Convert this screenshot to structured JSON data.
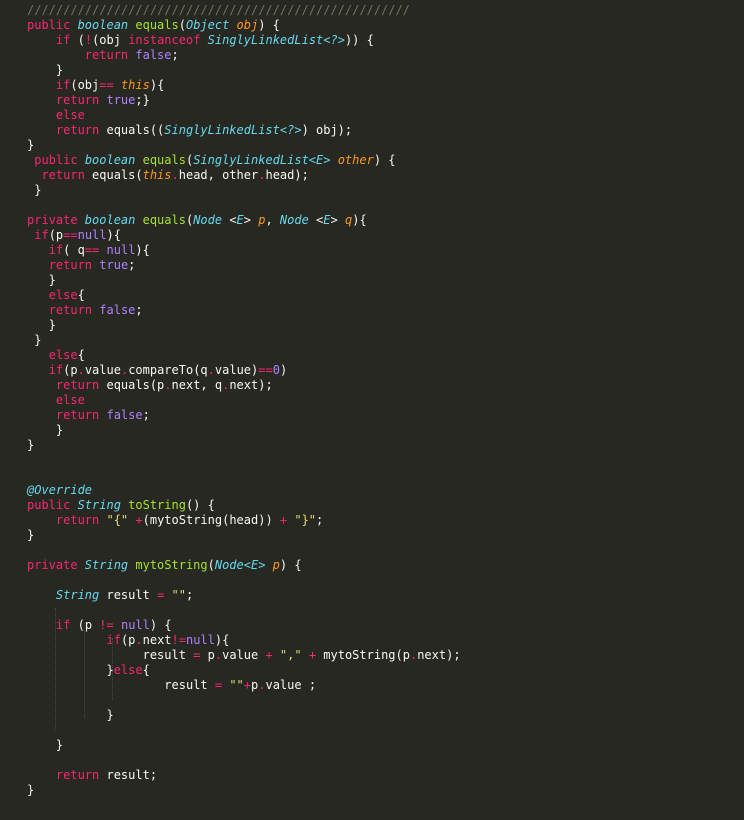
{
  "theme": {
    "background": "#272822",
    "keyword": "#f92672",
    "type": "#66d9ef",
    "function": "#a6e22e",
    "parameter": "#fd971f",
    "constant": "#ae81ff",
    "string": "#e6db74",
    "text": "#f8f8f2",
    "comment": "#75715e"
  },
  "editor": {
    "lines": [
      [
        {
          "t": "cm",
          "v": "/////////////////////////////////////////////////////"
        }
      ],
      [
        {
          "t": "kw",
          "v": "public "
        },
        {
          "t": "ty",
          "v": "boolean "
        },
        {
          "t": "fn",
          "v": "equals"
        },
        {
          "t": "tx",
          "v": "("
        },
        {
          "t": "ty",
          "v": "Object "
        },
        {
          "t": "pa",
          "v": "obj"
        },
        {
          "t": "tx",
          "v": ") {"
        }
      ],
      [
        {
          "t": "tx",
          "v": "    "
        },
        {
          "t": "kw",
          "v": "if "
        },
        {
          "t": "tx",
          "v": "("
        },
        {
          "t": "op",
          "v": "!"
        },
        {
          "t": "tx",
          "v": "(obj "
        },
        {
          "t": "kw",
          "v": "instanceof "
        },
        {
          "t": "ty",
          "v": "SinglyLinkedList<?>"
        },
        {
          "t": "tx",
          "v": ")) {"
        }
      ],
      [
        {
          "t": "tx",
          "v": "        "
        },
        {
          "t": "kw",
          "v": "return "
        },
        {
          "t": "co",
          "v": "false"
        },
        {
          "t": "tx",
          "v": ";"
        }
      ],
      [
        {
          "t": "tx",
          "v": "    }"
        }
      ],
      [
        {
          "t": "tx",
          "v": "    "
        },
        {
          "t": "kw",
          "v": "if"
        },
        {
          "t": "tx",
          "v": "(obj"
        },
        {
          "t": "op",
          "v": "== "
        },
        {
          "t": "pa",
          "v": "this"
        },
        {
          "t": "tx",
          "v": "){"
        }
      ],
      [
        {
          "t": "tx",
          "v": "    "
        },
        {
          "t": "kw",
          "v": "return "
        },
        {
          "t": "co",
          "v": "true"
        },
        {
          "t": "tx",
          "v": ";}"
        }
      ],
      [
        {
          "t": "tx",
          "v": "    "
        },
        {
          "t": "kw",
          "v": "else"
        }
      ],
      [
        {
          "t": "tx",
          "v": "    "
        },
        {
          "t": "kw",
          "v": "return "
        },
        {
          "t": "tx",
          "v": "equals(("
        },
        {
          "t": "ty",
          "v": "SinglyLinkedList<?>"
        },
        {
          "t": "tx",
          "v": ") obj);"
        }
      ],
      [
        {
          "t": "tx",
          "v": "}"
        }
      ],
      [
        {
          "t": "tx",
          "v": " "
        },
        {
          "t": "kw",
          "v": "public "
        },
        {
          "t": "ty",
          "v": "boolean "
        },
        {
          "t": "fn",
          "v": "equals"
        },
        {
          "t": "tx",
          "v": "("
        },
        {
          "t": "ty",
          "v": "SinglyLinkedList<E> "
        },
        {
          "t": "pa",
          "v": "other"
        },
        {
          "t": "tx",
          "v": ") {"
        }
      ],
      [
        {
          "t": "tx",
          "v": "  "
        },
        {
          "t": "kw",
          "v": "return "
        },
        {
          "t": "tx",
          "v": "equals("
        },
        {
          "t": "pa",
          "v": "this"
        },
        {
          "t": "op",
          "v": "."
        },
        {
          "t": "tx",
          "v": "head, other"
        },
        {
          "t": "op",
          "v": "."
        },
        {
          "t": "tx",
          "v": "head);"
        }
      ],
      [
        {
          "t": "tx",
          "v": " }"
        }
      ],
      [],
      [
        {
          "t": "kw",
          "v": "private "
        },
        {
          "t": "ty",
          "v": "boolean "
        },
        {
          "t": "fn",
          "v": "equals"
        },
        {
          "t": "tx",
          "v": "("
        },
        {
          "t": "ty",
          "v": "Node "
        },
        {
          "t": "tx",
          "v": "<"
        },
        {
          "t": "ty",
          "v": "E"
        },
        {
          "t": "tx",
          "v": "> "
        },
        {
          "t": "pa",
          "v": "p"
        },
        {
          "t": "tx",
          "v": ", "
        },
        {
          "t": "ty",
          "v": "Node "
        },
        {
          "t": "tx",
          "v": "<"
        },
        {
          "t": "ty",
          "v": "E"
        },
        {
          "t": "tx",
          "v": "> "
        },
        {
          "t": "pa",
          "v": "q"
        },
        {
          "t": "tx",
          "v": "){"
        }
      ],
      [
        {
          "t": "tx",
          "v": " "
        },
        {
          "t": "kw",
          "v": "if"
        },
        {
          "t": "tx",
          "v": "(p"
        },
        {
          "t": "op",
          "v": "=="
        },
        {
          "t": "co",
          "v": "null"
        },
        {
          "t": "tx",
          "v": "){"
        }
      ],
      [
        {
          "t": "tx",
          "v": "   "
        },
        {
          "t": "kw",
          "v": "if"
        },
        {
          "t": "tx",
          "v": "( q"
        },
        {
          "t": "op",
          "v": "== "
        },
        {
          "t": "co",
          "v": "null"
        },
        {
          "t": "tx",
          "v": "){"
        }
      ],
      [
        {
          "t": "tx",
          "v": "   "
        },
        {
          "t": "kw",
          "v": "return "
        },
        {
          "t": "co",
          "v": "true"
        },
        {
          "t": "tx",
          "v": ";"
        }
      ],
      [
        {
          "t": "tx",
          "v": "   }"
        }
      ],
      [
        {
          "t": "tx",
          "v": "   "
        },
        {
          "t": "kw",
          "v": "else"
        },
        {
          "t": "tx",
          "v": "{"
        }
      ],
      [
        {
          "t": "tx",
          "v": "   "
        },
        {
          "t": "kw",
          "v": "return "
        },
        {
          "t": "co",
          "v": "false"
        },
        {
          "t": "tx",
          "v": ";"
        }
      ],
      [
        {
          "t": "tx",
          "v": "   }"
        }
      ],
      [
        {
          "t": "tx",
          "v": " }"
        }
      ],
      [
        {
          "t": "tx",
          "v": "   "
        },
        {
          "t": "kw",
          "v": "else"
        },
        {
          "t": "tx",
          "v": "{"
        }
      ],
      [
        {
          "t": "tx",
          "v": "   "
        },
        {
          "t": "kw",
          "v": "if"
        },
        {
          "t": "tx",
          "v": "(p"
        },
        {
          "t": "op",
          "v": "."
        },
        {
          "t": "tx",
          "v": "value"
        },
        {
          "t": "op",
          "v": "."
        },
        {
          "t": "tx",
          "v": "compareTo(q"
        },
        {
          "t": "op",
          "v": "."
        },
        {
          "t": "tx",
          "v": "value)"
        },
        {
          "t": "op",
          "v": "=="
        },
        {
          "t": "co",
          "v": "0"
        },
        {
          "t": "tx",
          "v": ")"
        }
      ],
      [
        {
          "t": "tx",
          "v": "    "
        },
        {
          "t": "kw",
          "v": "return "
        },
        {
          "t": "tx",
          "v": "equals(p"
        },
        {
          "t": "op",
          "v": "."
        },
        {
          "t": "tx",
          "v": "next, q"
        },
        {
          "t": "op",
          "v": "."
        },
        {
          "t": "tx",
          "v": "next);"
        }
      ],
      [
        {
          "t": "tx",
          "v": "    "
        },
        {
          "t": "kw",
          "v": "else"
        }
      ],
      [
        {
          "t": "tx",
          "v": "    "
        },
        {
          "t": "kw",
          "v": "return "
        },
        {
          "t": "co",
          "v": "false"
        },
        {
          "t": "tx",
          "v": ";"
        }
      ],
      [
        {
          "t": "tx",
          "v": "    }"
        }
      ],
      [
        {
          "t": "tx",
          "v": "}"
        }
      ],
      [],
      [],
      [
        {
          "t": "an",
          "v": "@Override"
        }
      ],
      [
        {
          "t": "kw",
          "v": "public "
        },
        {
          "t": "ty",
          "v": "String "
        },
        {
          "t": "fn",
          "v": "toString"
        },
        {
          "t": "tx",
          "v": "() {"
        }
      ],
      [
        {
          "t": "tx",
          "v": "    "
        },
        {
          "t": "kw",
          "v": "return "
        },
        {
          "t": "st",
          "v": "\"{\" "
        },
        {
          "t": "op",
          "v": "+"
        },
        {
          "t": "tx",
          "v": "(mytoString(head)) "
        },
        {
          "t": "op",
          "v": "+ "
        },
        {
          "t": "st",
          "v": "\"}\""
        },
        {
          "t": "tx",
          "v": ";"
        }
      ],
      [
        {
          "t": "tx",
          "v": "}"
        }
      ],
      [],
      [
        {
          "t": "kw",
          "v": "private "
        },
        {
          "t": "ty",
          "v": "String "
        },
        {
          "t": "fn",
          "v": "mytoString"
        },
        {
          "t": "tx",
          "v": "("
        },
        {
          "t": "ty",
          "v": "Node<E> "
        },
        {
          "t": "pa",
          "v": "p"
        },
        {
          "t": "tx",
          "v": ") {"
        }
      ],
      [],
      [
        {
          "t": "tx",
          "v": "    "
        },
        {
          "t": "ty",
          "v": "String "
        },
        {
          "t": "tx",
          "v": "result "
        },
        {
          "t": "op",
          "v": "= "
        },
        {
          "t": "st",
          "v": "\"\""
        },
        {
          "t": "tx",
          "v": ";"
        }
      ],
      [],
      [
        {
          "t": "tx",
          "v": "    "
        },
        {
          "t": "kw",
          "v": "if "
        },
        {
          "t": "tx",
          "v": "(p "
        },
        {
          "t": "op",
          "v": "!= "
        },
        {
          "t": "co",
          "v": "null"
        },
        {
          "t": "tx",
          "v": ") {"
        }
      ],
      [
        {
          "t": "tx",
          "v": "           "
        },
        {
          "t": "kw",
          "v": "if"
        },
        {
          "t": "tx",
          "v": "(p"
        },
        {
          "t": "op",
          "v": "."
        },
        {
          "t": "tx",
          "v": "next"
        },
        {
          "t": "op",
          "v": "!="
        },
        {
          "t": "co",
          "v": "null"
        },
        {
          "t": "tx",
          "v": "){"
        }
      ],
      [
        {
          "t": "tx",
          "v": "                "
        },
        {
          "t": "tx",
          "v": "result "
        },
        {
          "t": "op",
          "v": "= "
        },
        {
          "t": "tx",
          "v": "p"
        },
        {
          "t": "op",
          "v": "."
        },
        {
          "t": "tx",
          "v": "value "
        },
        {
          "t": "op",
          "v": "+ "
        },
        {
          "t": "st",
          "v": "\",\" "
        },
        {
          "t": "op",
          "v": "+ "
        },
        {
          "t": "tx",
          "v": "mytoString(p"
        },
        {
          "t": "op",
          "v": "."
        },
        {
          "t": "tx",
          "v": "next);"
        }
      ],
      [
        {
          "t": "tx",
          "v": "           }"
        },
        {
          "t": "kw",
          "v": "else"
        },
        {
          "t": "tx",
          "v": "{"
        }
      ],
      [
        {
          "t": "tx",
          "v": "                   "
        },
        {
          "t": "tx",
          "v": "result "
        },
        {
          "t": "op",
          "v": "= "
        },
        {
          "t": "st",
          "v": "\"\""
        },
        {
          "t": "op",
          "v": "+"
        },
        {
          "t": "tx",
          "v": "p"
        },
        {
          "t": "op",
          "v": "."
        },
        {
          "t": "tx",
          "v": "value ;"
        }
      ],
      [],
      [
        {
          "t": "tx",
          "v": "           }"
        }
      ],
      [],
      [
        {
          "t": "tx",
          "v": "    }"
        }
      ],
      [],
      [
        {
          "t": "tx",
          "v": "    "
        },
        {
          "t": "kw",
          "v": "return "
        },
        {
          "t": "tx",
          "v": "result;"
        }
      ],
      [
        {
          "t": "tx",
          "v": "}"
        }
      ]
    ]
  }
}
